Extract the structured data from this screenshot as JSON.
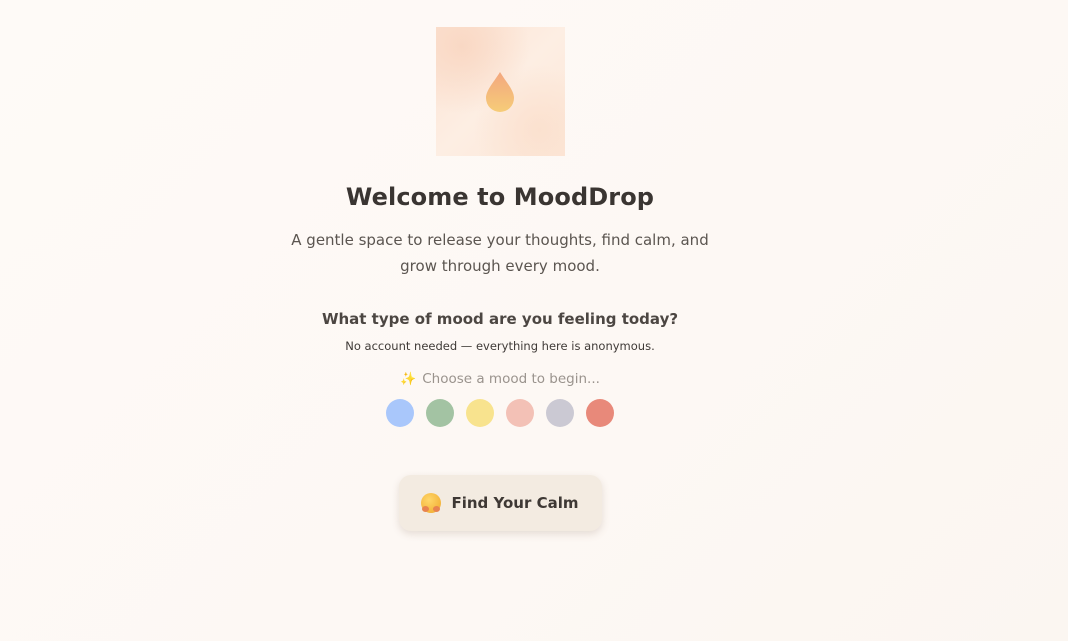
{
  "hero": {
    "icon": "water-drop-icon"
  },
  "title": "Welcome to MoodDrop",
  "subtitle": "A gentle space to release your thoughts, find calm, and grow through every mood.",
  "question": "What type of mood are you feeling today?",
  "note": "No account needed — everything here is anonymous.",
  "prompt": {
    "icon": "sparkles-icon",
    "text": "Choose a mood to begin..."
  },
  "moods": [
    {
      "color": "#a9c7fb"
    },
    {
      "color": "#a3c3a3"
    },
    {
      "color": "#f8e38e"
    },
    {
      "color": "#f3c1b6"
    },
    {
      "color": "#cbc9d3"
    },
    {
      "color": "#e8897a"
    }
  ],
  "cta": {
    "icon": "hugging-face-icon",
    "label": "Find Your Calm"
  }
}
